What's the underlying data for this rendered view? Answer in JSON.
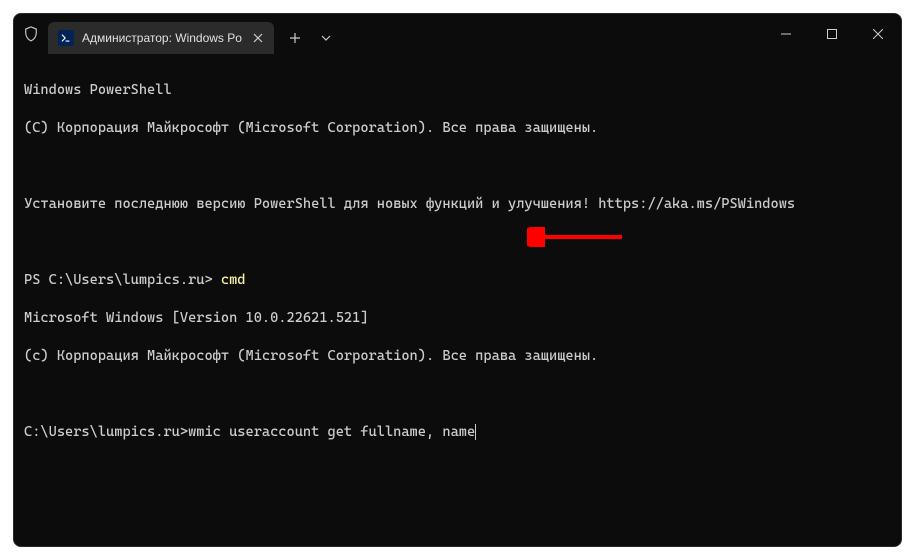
{
  "titlebar": {
    "tab_title": "Администратор: Windows Po",
    "new_tab_glyph": "+",
    "close_glyph": "✕",
    "dropdown_glyph": "⌄"
  },
  "terminal": {
    "header1": "Windows PowerShell",
    "header2": "(C) Корпорация Майкрософт (Microsoft Corporation). Все права защищены.",
    "notice": "Установите последнюю версию PowerShell для новых функций и улучшения! https://aka.ms/PSWindows",
    "ps_prompt_prefix": "PS ",
    "ps_path": "C:\\Users\\lumpics.ru",
    "ps_gt": "> ",
    "ps_input": "cmd",
    "cmd_version": "Microsoft Windows [Version 10.0.22621.521]",
    "cmd_copyright": "(c) Корпорация Майкрософт (Microsoft Corporation). Все права защищены.",
    "cmd_prompt_path": "C:\\Users\\lumpics.ru>",
    "cmd_input": "wmic useraccount get fullname, name"
  },
  "annotation": {
    "arrow_color": "#ff0000"
  }
}
